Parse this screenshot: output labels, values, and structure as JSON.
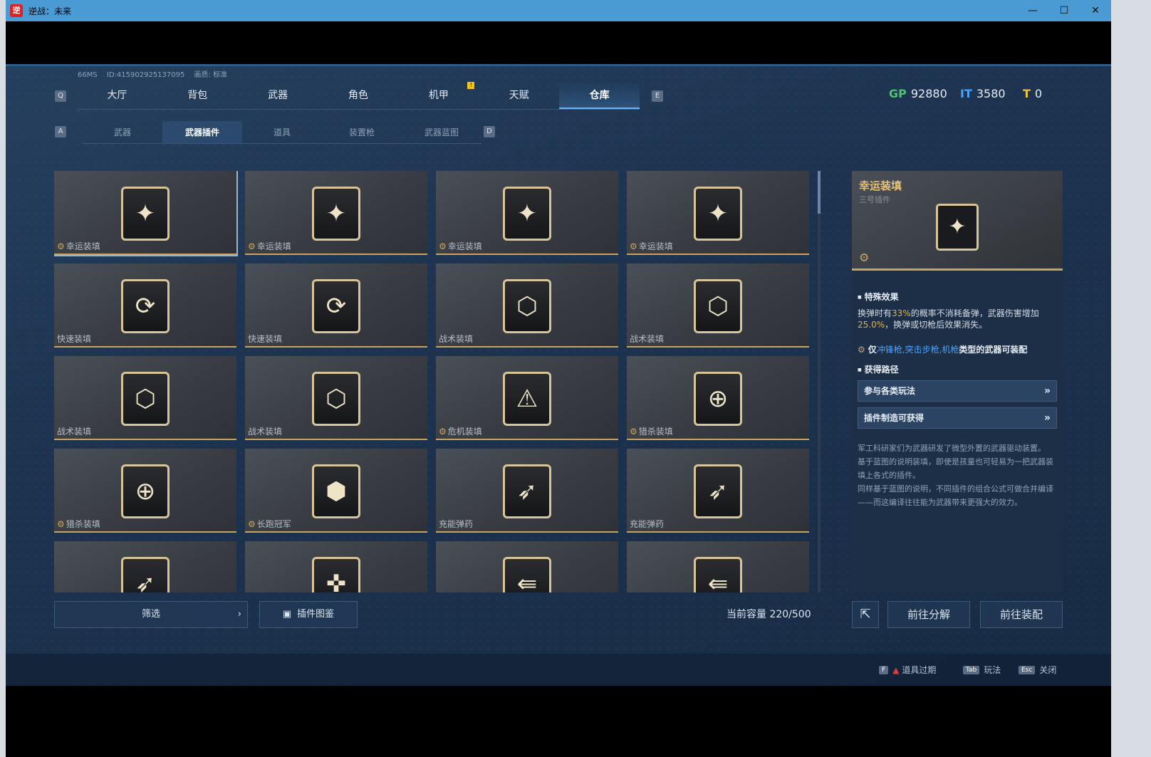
{
  "window": {
    "title": "逆战：未来",
    "app_icon": "逆",
    "minimize": "—",
    "maximize": "☐",
    "close": "✕"
  },
  "meta": {
    "ping": "66MS",
    "id": "ID:415902925137095",
    "quality": "画质: 标准"
  },
  "keys": {
    "left_main": "Q",
    "right_main": "E",
    "left_sub": "A",
    "right_sub": "D"
  },
  "main_tabs": [
    {
      "label": "大厅"
    },
    {
      "label": "背包"
    },
    {
      "label": "武器"
    },
    {
      "label": "角色"
    },
    {
      "label": "机甲",
      "badge": "!"
    },
    {
      "label": "天赋"
    },
    {
      "label": "仓库",
      "active": true
    }
  ],
  "currency": [
    {
      "icon": "gp-icon",
      "symbol": "GP",
      "value": "92880"
    },
    {
      "icon": "ticket-icon",
      "symbol": "IT",
      "value": "3580"
    },
    {
      "icon": "coin-icon",
      "symbol": "T",
      "value": "0"
    }
  ],
  "sub_tabs": [
    {
      "label": "武器"
    },
    {
      "label": "武器插件",
      "active": true
    },
    {
      "label": "道具"
    },
    {
      "label": "装置枪"
    },
    {
      "label": "武器蓝图"
    }
  ],
  "items": [
    {
      "name": "幸运装填",
      "emblem": true,
      "icon": "winged-bullet-icon",
      "glyph": "✦"
    },
    {
      "name": "幸运装填",
      "emblem": true,
      "icon": "winged-bullet-icon",
      "glyph": "✦"
    },
    {
      "name": "幸运装填",
      "emblem": true,
      "icon": "winged-bullet-icon",
      "glyph": "✦"
    },
    {
      "name": "幸运装填",
      "emblem": true,
      "icon": "winged-bullet-icon",
      "glyph": "✦"
    },
    {
      "name": "快速装填",
      "emblem": false,
      "icon": "fast-reload-icon",
      "glyph": "⟳"
    },
    {
      "name": "快速装填",
      "emblem": false,
      "icon": "fast-reload-icon",
      "glyph": "⟳"
    },
    {
      "name": "战术装填",
      "emblem": false,
      "icon": "tactical-reload-icon",
      "glyph": "⬡"
    },
    {
      "name": "战术装填",
      "emblem": false,
      "icon": "tactical-reload-icon",
      "glyph": "⬡"
    },
    {
      "name": "战术装填",
      "emblem": false,
      "icon": "tactical-reload-icon",
      "glyph": "⬡"
    },
    {
      "name": "战术装填",
      "emblem": false,
      "icon": "tactical-reload-icon",
      "glyph": "⬡"
    },
    {
      "name": "危机装填",
      "emblem": true,
      "icon": "crisis-reload-icon",
      "glyph": "⚠"
    },
    {
      "name": "猎杀装填",
      "emblem": true,
      "icon": "crosshair-ammo-icon",
      "glyph": "⊕"
    },
    {
      "name": "猎杀装填",
      "emblem": true,
      "icon": "crosshair-ammo-icon",
      "glyph": "⊕"
    },
    {
      "name": "长跑冠军",
      "emblem": true,
      "icon": "runner-ammo-icon",
      "glyph": "⬢"
    },
    {
      "name": "充能弹药",
      "emblem": false,
      "icon": "charged-ammo-icon",
      "glyph": "➶"
    },
    {
      "name": "充能弹药",
      "emblem": false,
      "icon": "charged-ammo-icon",
      "glyph": "➶"
    },
    {
      "name": "",
      "emblem": false,
      "icon": "charged-ammo-icon",
      "glyph": "➶"
    },
    {
      "name": "",
      "emblem": false,
      "icon": "gun-plugin-icon",
      "glyph": "✜"
    },
    {
      "name": "",
      "emblem": false,
      "icon": "arrow-plugin-icon",
      "glyph": "⇚"
    },
    {
      "name": "",
      "emblem": false,
      "icon": "arrow-plugin-icon",
      "glyph": "⇚"
    }
  ],
  "detail": {
    "name": "幸运装填",
    "subtitle": "三号插件",
    "glyph": "✦",
    "effect_title": "特殊效果",
    "effect_a": "换弹时有",
    "effect_pct1": "33%",
    "effect_b": "的概率不消耗备弹，武器伤害增加",
    "effect_pct2": "25.0%",
    "effect_c": "，换弹或切枪后效果消失。",
    "restrict_prefix": "仅",
    "restrict_types": "冲锋枪,突击步枪,机枪",
    "restrict_suffix": "类型的武器可装配",
    "source_title": "获得路径",
    "sources": [
      {
        "label": "参与各类玩法"
      },
      {
        "label": "插件制造可获得"
      }
    ],
    "lore": [
      "军工科研家们为武器研发了微型外置的武器驱动装置。",
      "基于蓝图的说明装填，即使是孩童也可轻易为一把武器装填上各式的插件。",
      "同样基于蓝图的说明，不同插件的组合公式可做合并编译——而这编译往往能为武器带来更强大的效力。"
    ]
  },
  "bottom": {
    "filter": "筛选",
    "catalog": "插件图鉴",
    "capacity": "当前容量 220/500",
    "decompose": "前往分解",
    "equip": "前往装配"
  },
  "footer": [
    {
      "key": "F",
      "label": "道具过期",
      "warn": true
    },
    {
      "key": "Tab",
      "label": "玩法"
    },
    {
      "key": "Esc",
      "label": "关闭"
    }
  ]
}
